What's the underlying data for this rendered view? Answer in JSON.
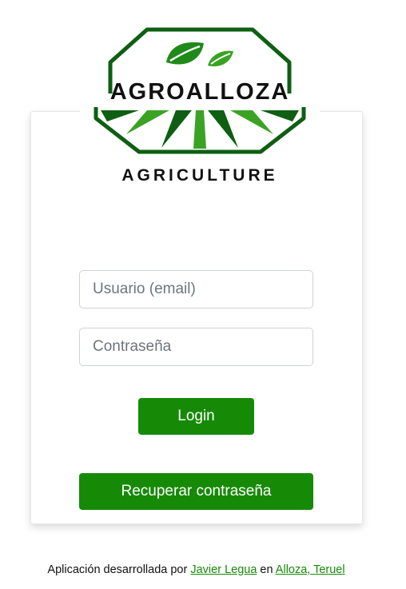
{
  "logo": {
    "brand_text": "AGROALLOZA",
    "tagline": "AGRICULTURE",
    "colors": {
      "dark_green": "#0e5f12",
      "light_green": "#3aa324",
      "text": "#111111"
    }
  },
  "form": {
    "email_placeholder": "Usuario (email)",
    "password_placeholder": "Contraseña",
    "login_label": "Login",
    "recover_label": "Recuperar contraseña"
  },
  "footer": {
    "prefix": "Aplicación desarrollada por",
    "author_link": "Javier Legua",
    "connector": "en",
    "location_link": "Alloza, Teruel"
  },
  "colors": {
    "accent": "#168a07"
  }
}
